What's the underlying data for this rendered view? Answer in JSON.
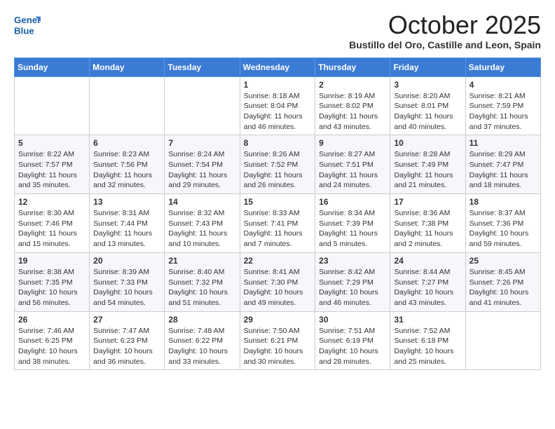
{
  "logo": {
    "general": "General",
    "blue": "Blue"
  },
  "title": "October 2025",
  "subtitle": "Bustillo del Oro, Castille and Leon, Spain",
  "weekdays": [
    "Sunday",
    "Monday",
    "Tuesday",
    "Wednesday",
    "Thursday",
    "Friday",
    "Saturday"
  ],
  "weeks": [
    [
      {
        "day": "",
        "sunrise": "",
        "sunset": "",
        "daylight": ""
      },
      {
        "day": "",
        "sunrise": "",
        "sunset": "",
        "daylight": ""
      },
      {
        "day": "",
        "sunrise": "",
        "sunset": "",
        "daylight": ""
      },
      {
        "day": "1",
        "sunrise": "Sunrise: 8:18 AM",
        "sunset": "Sunset: 8:04 PM",
        "daylight": "Daylight: 11 hours and 46 minutes."
      },
      {
        "day": "2",
        "sunrise": "Sunrise: 8:19 AM",
        "sunset": "Sunset: 8:02 PM",
        "daylight": "Daylight: 11 hours and 43 minutes."
      },
      {
        "day": "3",
        "sunrise": "Sunrise: 8:20 AM",
        "sunset": "Sunset: 8:01 PM",
        "daylight": "Daylight: 11 hours and 40 minutes."
      },
      {
        "day": "4",
        "sunrise": "Sunrise: 8:21 AM",
        "sunset": "Sunset: 7:59 PM",
        "daylight": "Daylight: 11 hours and 37 minutes."
      }
    ],
    [
      {
        "day": "5",
        "sunrise": "Sunrise: 8:22 AM",
        "sunset": "Sunset: 7:57 PM",
        "daylight": "Daylight: 11 hours and 35 minutes."
      },
      {
        "day": "6",
        "sunrise": "Sunrise: 8:23 AM",
        "sunset": "Sunset: 7:56 PM",
        "daylight": "Daylight: 11 hours and 32 minutes."
      },
      {
        "day": "7",
        "sunrise": "Sunrise: 8:24 AM",
        "sunset": "Sunset: 7:54 PM",
        "daylight": "Daylight: 11 hours and 29 minutes."
      },
      {
        "day": "8",
        "sunrise": "Sunrise: 8:26 AM",
        "sunset": "Sunset: 7:52 PM",
        "daylight": "Daylight: 11 hours and 26 minutes."
      },
      {
        "day": "9",
        "sunrise": "Sunrise: 8:27 AM",
        "sunset": "Sunset: 7:51 PM",
        "daylight": "Daylight: 11 hours and 24 minutes."
      },
      {
        "day": "10",
        "sunrise": "Sunrise: 8:28 AM",
        "sunset": "Sunset: 7:49 PM",
        "daylight": "Daylight: 11 hours and 21 minutes."
      },
      {
        "day": "11",
        "sunrise": "Sunrise: 8:29 AM",
        "sunset": "Sunset: 7:47 PM",
        "daylight": "Daylight: 11 hours and 18 minutes."
      }
    ],
    [
      {
        "day": "12",
        "sunrise": "Sunrise: 8:30 AM",
        "sunset": "Sunset: 7:46 PM",
        "daylight": "Daylight: 11 hours and 15 minutes."
      },
      {
        "day": "13",
        "sunrise": "Sunrise: 8:31 AM",
        "sunset": "Sunset: 7:44 PM",
        "daylight": "Daylight: 11 hours and 13 minutes."
      },
      {
        "day": "14",
        "sunrise": "Sunrise: 8:32 AM",
        "sunset": "Sunset: 7:43 PM",
        "daylight": "Daylight: 11 hours and 10 minutes."
      },
      {
        "day": "15",
        "sunrise": "Sunrise: 8:33 AM",
        "sunset": "Sunset: 7:41 PM",
        "daylight": "Daylight: 11 hours and 7 minutes."
      },
      {
        "day": "16",
        "sunrise": "Sunrise: 8:34 AM",
        "sunset": "Sunset: 7:39 PM",
        "daylight": "Daylight: 11 hours and 5 minutes."
      },
      {
        "day": "17",
        "sunrise": "Sunrise: 8:36 AM",
        "sunset": "Sunset: 7:38 PM",
        "daylight": "Daylight: 11 hours and 2 minutes."
      },
      {
        "day": "18",
        "sunrise": "Sunrise: 8:37 AM",
        "sunset": "Sunset: 7:36 PM",
        "daylight": "Daylight: 10 hours and 59 minutes."
      }
    ],
    [
      {
        "day": "19",
        "sunrise": "Sunrise: 8:38 AM",
        "sunset": "Sunset: 7:35 PM",
        "daylight": "Daylight: 10 hours and 56 minutes."
      },
      {
        "day": "20",
        "sunrise": "Sunrise: 8:39 AM",
        "sunset": "Sunset: 7:33 PM",
        "daylight": "Daylight: 10 hours and 54 minutes."
      },
      {
        "day": "21",
        "sunrise": "Sunrise: 8:40 AM",
        "sunset": "Sunset: 7:32 PM",
        "daylight": "Daylight: 10 hours and 51 minutes."
      },
      {
        "day": "22",
        "sunrise": "Sunrise: 8:41 AM",
        "sunset": "Sunset: 7:30 PM",
        "daylight": "Daylight: 10 hours and 49 minutes."
      },
      {
        "day": "23",
        "sunrise": "Sunrise: 8:42 AM",
        "sunset": "Sunset: 7:29 PM",
        "daylight": "Daylight: 10 hours and 46 minutes."
      },
      {
        "day": "24",
        "sunrise": "Sunrise: 8:44 AM",
        "sunset": "Sunset: 7:27 PM",
        "daylight": "Daylight: 10 hours and 43 minutes."
      },
      {
        "day": "25",
        "sunrise": "Sunrise: 8:45 AM",
        "sunset": "Sunset: 7:26 PM",
        "daylight": "Daylight: 10 hours and 41 minutes."
      }
    ],
    [
      {
        "day": "26",
        "sunrise": "Sunrise: 7:46 AM",
        "sunset": "Sunset: 6:25 PM",
        "daylight": "Daylight: 10 hours and 38 minutes."
      },
      {
        "day": "27",
        "sunrise": "Sunrise: 7:47 AM",
        "sunset": "Sunset: 6:23 PM",
        "daylight": "Daylight: 10 hours and 36 minutes."
      },
      {
        "day": "28",
        "sunrise": "Sunrise: 7:48 AM",
        "sunset": "Sunset: 6:22 PM",
        "daylight": "Daylight: 10 hours and 33 minutes."
      },
      {
        "day": "29",
        "sunrise": "Sunrise: 7:50 AM",
        "sunset": "Sunset: 6:21 PM",
        "daylight": "Daylight: 10 hours and 30 minutes."
      },
      {
        "day": "30",
        "sunrise": "Sunrise: 7:51 AM",
        "sunset": "Sunset: 6:19 PM",
        "daylight": "Daylight: 10 hours and 28 minutes."
      },
      {
        "day": "31",
        "sunrise": "Sunrise: 7:52 AM",
        "sunset": "Sunset: 6:18 PM",
        "daylight": "Daylight: 10 hours and 25 minutes."
      },
      {
        "day": "",
        "sunrise": "",
        "sunset": "",
        "daylight": ""
      }
    ]
  ]
}
